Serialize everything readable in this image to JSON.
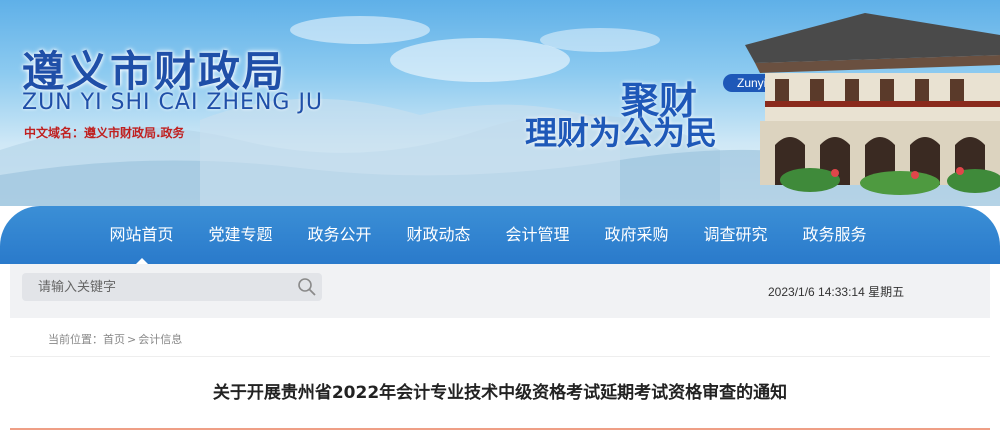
{
  "header": {
    "title": "遵义市财政局",
    "subtitle": "ZUN YI SHI CAI ZHENG JU",
    "domain_label": "中文域名：遵义市财政局.政务",
    "slogan_top": "聚财",
    "slogan_bottom": "理财为公为民",
    "slogan_badge": "Zunyi"
  },
  "nav": {
    "items": [
      "网站首页",
      "党建专题",
      "政务公开",
      "财政动态",
      "会计管理",
      "政府采购",
      "调查研究",
      "政务服务"
    ],
    "active_index": 0
  },
  "search": {
    "placeholder": "请输入关键字"
  },
  "datetime": "2023/1/6 14:33:14 星期五",
  "breadcrumb": {
    "prefix": "当前位置：",
    "items": [
      "首页",
      "会计信息"
    ],
    "separator": ">"
  },
  "article": {
    "title": "关于开展贵州省2022年会计专业技术中级资格考试延期考试资格审查的通知"
  },
  "colors": {
    "nav_bg": "#2a7acb",
    "title_blue": "#1f4fa8",
    "accent_rule": "#ef9f86"
  },
  "icons": {
    "search": "magnifier-icon"
  }
}
